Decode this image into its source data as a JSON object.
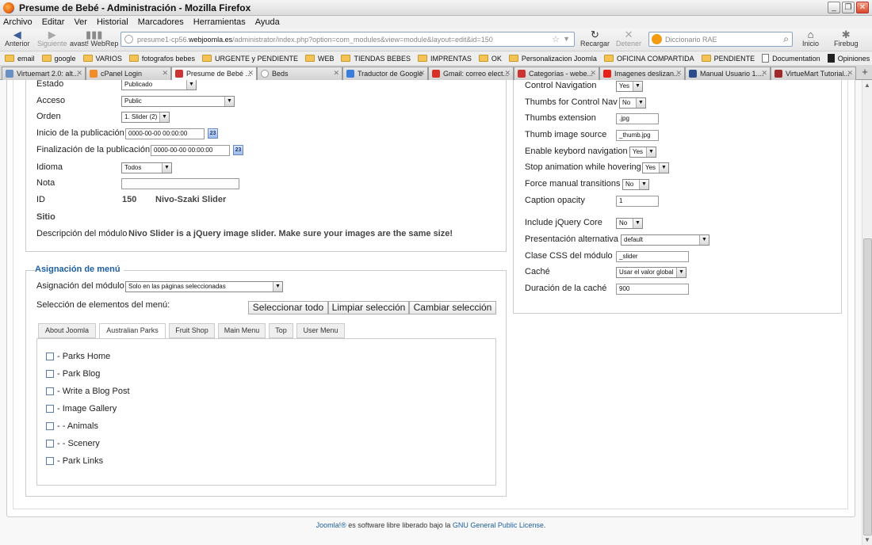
{
  "window": {
    "title": "Presume de Bebé - Administración - Mozilla Firefox"
  },
  "menu": [
    "Archivo",
    "Editar",
    "Ver",
    "Historial",
    "Marcadores",
    "Herramientas",
    "Ayuda"
  ],
  "nav": {
    "back": "Anterior",
    "forward": "Siguiente",
    "avast": "avast! WebRep",
    "reload": "Recargar",
    "stop": "Detener",
    "home": "Inicio",
    "firebug": "Firebug",
    "url_prefix": "presume1-cp56.",
    "url_domain": "webjoomla.es",
    "url_path": "/administrator/index.php?option=com_modules&view=module&layout=edit&id=150",
    "search_placeholder": "Diccionario RAE"
  },
  "bookmarks": [
    "email",
    "google",
    "VARIOS",
    "fotografos bebes",
    "URGENTE y PENDIENTE",
    "WEB",
    "TIENDAS BEBES",
    "IMPRENTAS",
    "OK",
    "Personalizacion Joomla",
    "OFICINA COMPARTIDA",
    "PENDIENTE",
    "Documentation",
    "Opiniones del sector e..."
  ],
  "tabs": [
    "Virtuemart 2.0: alt...",
    "cPanel Login",
    "Presume de Bebé ...",
    "Beds",
    "Traductor de Google",
    "Gmail: correo elect...",
    "Categorías - webe...",
    "Imagenes deslizan...",
    "Manual Usuario 1....",
    "VirtueMart Tutorial..."
  ],
  "details": {
    "estado_label": "Estado",
    "estado_value": "Publicado",
    "acceso_label": "Acceso",
    "acceso_value": "Public",
    "orden_label": "Orden",
    "orden_value": "1. Slider (2)",
    "inicio_label": "Inicio de la publicación",
    "inicio_value": "0000-00-00 00:00:00",
    "fin_label": "Finalización de la publicación",
    "fin_value": "0000-00-00 00:00:00",
    "idioma_label": "Idioma",
    "idioma_value": "Todos",
    "nota_label": "Nota",
    "nota_value": "",
    "id_label": "ID",
    "id_value": "150",
    "module_name": "Nivo-Szaki Slider",
    "sitio_label": "Sitio",
    "desc_label": "Descripción del módulo",
    "desc_value": "Nivo Slider is a jQuery image slider. Make sure your images are the same size!",
    "calendar_glyph": "23"
  },
  "menu_assign": {
    "legend": "Asignación de menú",
    "module_label": "Asignación del módulo",
    "module_value": "Solo en las páginas seleccionadas",
    "selection_label": "Selección de elementos del menú:",
    "btn_select_all": "Seleccionar todo",
    "btn_clear": "Limpiar selección",
    "btn_toggle": "Cambiar selección",
    "tabs": [
      "About Joomla",
      "Australian Parks",
      "Fruit Shop",
      "Main Menu",
      "Top",
      "User Menu"
    ],
    "items": [
      "- Parks Home",
      "- Park Blog",
      "- Write a Blog Post",
      "- Image Gallery",
      "- - Animals",
      "- - Scenery",
      "- Park Links"
    ]
  },
  "options": {
    "control_nav_label": "Control Navigation",
    "control_nav_value": "Yes",
    "thumbs_nav_label": "Thumbs for Control Nav",
    "thumbs_nav_value": "No",
    "thumbs_ext_label": "Thumbs extension",
    "thumbs_ext_value": ".jpg",
    "thumb_src_label": "Thumb image source",
    "thumb_src_value": "_thumb.jpg",
    "keyboard_label": "Enable keybord navigation",
    "keyboard_value": "Yes",
    "stop_hover_label": "Stop animation while hovering",
    "stop_hover_value": "Yes",
    "force_manual_label": "Force manual transitions",
    "force_manual_value": "No",
    "caption_opacity_label": "Caption opacity",
    "caption_opacity_value": "1",
    "jquery_label": "Include jQuery Core",
    "jquery_value": "No",
    "layout_label": "Presentación alternativa",
    "layout_value": "default",
    "css_label": "Clase CSS del módulo",
    "css_value": "_slider",
    "cache_label": "Caché",
    "cache_value": "Usar el valor global",
    "cache_time_label": "Duración de la caché",
    "cache_time_value": "900"
  },
  "footer": {
    "joomla_link": "Joomla!®",
    "text": " es software libre liberado bajo la ",
    "license_link": "GNU General Public License",
    "end": "."
  }
}
